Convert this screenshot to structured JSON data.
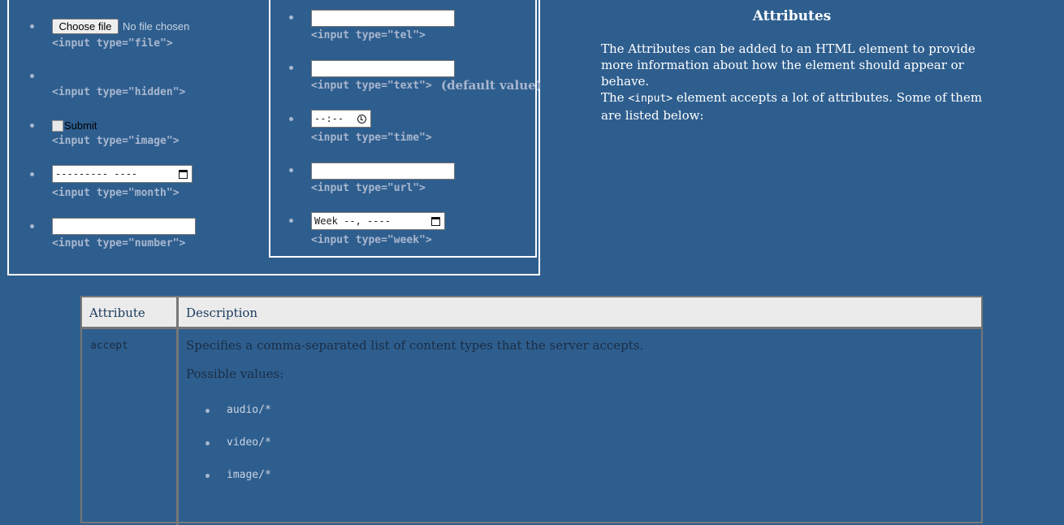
{
  "left_column": {
    "file": {
      "button_label": "Choose file",
      "status": "No file chosen",
      "code": "<input type=\"file\">"
    },
    "hidden": {
      "code": "<input type=\"hidden\">"
    },
    "image": {
      "alt": "Submit",
      "code": "<input type=\"image\">"
    },
    "month": {
      "placeholder": "--------- ----",
      "code": "<input type=\"month\">"
    },
    "number": {
      "value": "",
      "code": "<input type=\"number\">"
    }
  },
  "mid_column": {
    "tel": {
      "value": "",
      "code": "<input type=\"tel\">"
    },
    "text": {
      "value": "",
      "code": "<input type=\"text\">",
      "note": "(default value)"
    },
    "time": {
      "placeholder": "--:--",
      "code": "<input type=\"time\">"
    },
    "url": {
      "value": "",
      "code": "<input type=\"url\">"
    },
    "week": {
      "placeholder": "Week --, ----",
      "code": "<input type=\"week\">"
    }
  },
  "attributes_section": {
    "title": "Attributes",
    "para1": "The Attributes can be added to an HTML element to provide more information about how the element should appear or behave.",
    "para2_pre": "The ",
    "para2_code": "<input>",
    "para2_post": " element accepts a lot of attributes. Some of them are listed below:"
  },
  "table": {
    "headers": [
      "Attribute",
      "Description"
    ],
    "row1": {
      "attribute": "accept",
      "description": "Specifies a comma-separated list of content types that the server accepts.",
      "possible_label": "Possible values:",
      "values": [
        "audio/*",
        "video/*",
        "image/*"
      ]
    }
  }
}
